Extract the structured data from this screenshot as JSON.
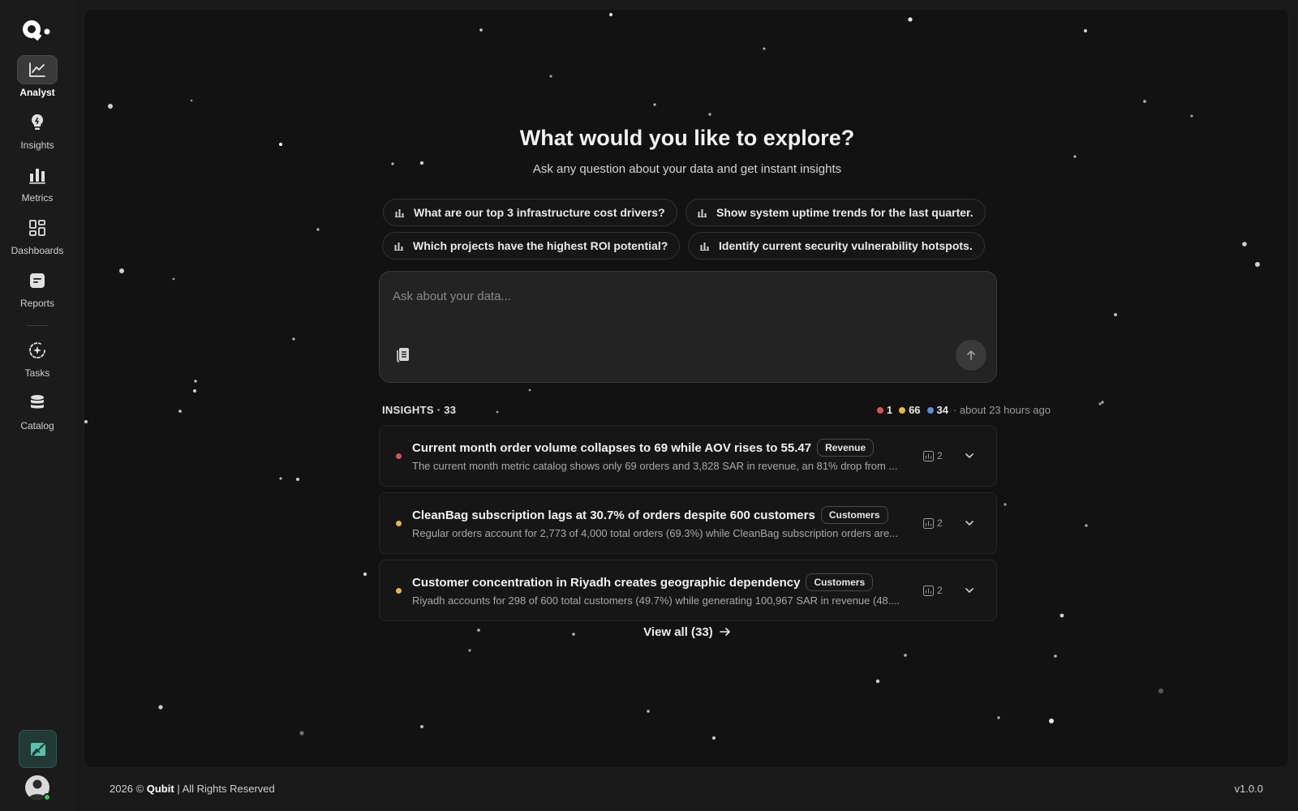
{
  "nav": {
    "items": [
      {
        "label": "Analyst",
        "icon": "line-chart-icon",
        "active": true
      },
      {
        "label": "Insights",
        "icon": "lightbulb-icon",
        "active": false
      },
      {
        "label": "Metrics",
        "icon": "bar-chart-icon",
        "active": false
      },
      {
        "label": "Dashboards",
        "icon": "dashboard-grid-icon",
        "active": false
      },
      {
        "label": "Reports",
        "icon": "report-icon",
        "active": false
      },
      {
        "label": "Tasks",
        "icon": "tasks-sparkle-icon",
        "active": false
      },
      {
        "label": "Catalog",
        "icon": "database-icon",
        "active": false
      }
    ]
  },
  "hero": {
    "title": "What would you like to explore?",
    "subtitle": "Ask any question about your data and get instant insights"
  },
  "suggestions": [
    "What are our top 3 infrastructure cost drivers?",
    "Show system uptime trends for the last quarter.",
    "Which projects have the highest ROI potential?",
    "Identify current security vulnerability hotspots."
  ],
  "ask": {
    "placeholder": "Ask about your data..."
  },
  "insights": {
    "header": "INSIGHTS · 33",
    "counts": [
      {
        "value": "1",
        "color": "#d9534f"
      },
      {
        "value": "66",
        "color": "#e6b84a"
      },
      {
        "value": "34",
        "color": "#5b8fd6"
      }
    ],
    "updated": "· about 23 hours ago",
    "items": [
      {
        "title": "Current month order volume collapses to 69 while AOV rises to 55.47",
        "tag": "Revenue",
        "description": "The current month metric catalog shows only 69 orders and 3,828 SAR in revenue, an 81% drop from ...",
        "evidence": "2",
        "severity_color": "#d9534f"
      },
      {
        "title": "CleanBag subscription lags at 30.7% of orders despite 600 customers",
        "tag": "Customers",
        "description": "Regular orders account for 2,773 of 4,000 total orders (69.3%) while CleanBag subscription orders are...",
        "evidence": "2",
        "severity_color": "#e6b84a"
      },
      {
        "title": "Customer concentration in Riyadh creates geographic dependency",
        "tag": "Customers",
        "description": "Riyadh accounts for 298 of 600 total customers (49.7%) while generating 100,967 SAR in revenue (48....",
        "evidence": "2",
        "severity_color": "#e6b84a"
      }
    ],
    "view_all": "View all (33)"
  },
  "footer": {
    "year_copy": "2026 ©",
    "brand": "Qubit",
    "rights": "| All Rights Reserved",
    "version": "v1.0.0"
  }
}
